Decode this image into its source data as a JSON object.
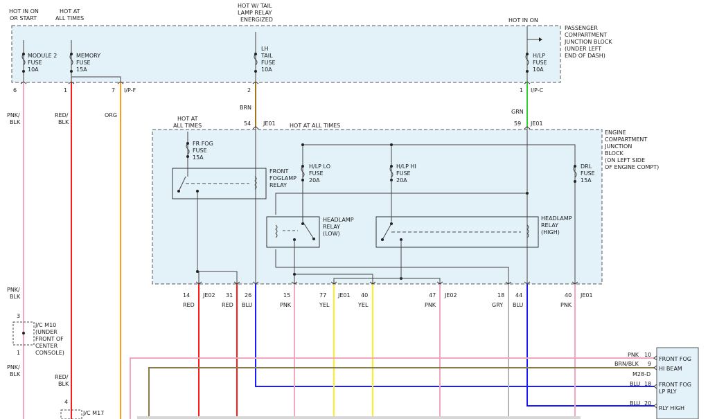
{
  "colors": {
    "pnk": "#f2a7bf",
    "red": "#ff1a1a",
    "org": "#ff9a1a",
    "brn": "#a0751f",
    "grn": "#33cc33",
    "blu": "#1a1aff",
    "yel": "#ffee22",
    "gry": "#b5b5b5",
    "brn_blk": "#8a7a4a",
    "box_fill": "#e3f1f9"
  },
  "top_labels": {
    "hot_in_on_or_start_1": "HOT IN ON",
    "hot_in_on_or_start_2": "OR START",
    "hot_at_all_times_1": "HOT AT",
    "hot_at_all_times_2": "ALL TIMES",
    "hot_tail_1": "HOT W/ TAIL",
    "hot_tail_2": "LAMP RELAY",
    "hot_tail_3": "ENERGIZED",
    "hot_in_on": "HOT IN ON"
  },
  "passenger_block": {
    "line1": "PASSENGER",
    "line2": "COMPARTMENT",
    "line3": "JUNCTION BLOCK",
    "line4": "(UNDER LEFT",
    "line5": "END OF DASH)",
    "fuses": [
      {
        "l1": "MODULE 2",
        "l2": "FUSE",
        "l3": "10A"
      },
      {
        "l1": "MEMORY",
        "l2": "FUSE",
        "l3": "15A"
      },
      {
        "l1": "LH",
        "l2": "TAIL",
        "l3": "FUSE",
        "l4": "10A"
      },
      {
        "l1": "H/LP",
        "l2": "FUSE",
        "l3": "10A"
      }
    ],
    "pins": {
      "p6": "6",
      "p1": "1",
      "p7": "7",
      "ipf": "I/P-F",
      "p2": "2",
      "p1b": "1",
      "ipc": "I/P-C"
    }
  },
  "engine_block": {
    "line1": "ENGINE",
    "line2": "COMPARTMENT",
    "line3": "JUNCTION",
    "line4": "BLOCK",
    "line5": "(ON LEFT SIDE",
    "line6": "OF ENGINE COMPT)",
    "hot_at_1": "HOT AT",
    "hot_at_2": "ALL TIMES",
    "hot_all_times": "HOT AT ALL TIMES",
    "fr_fog": {
      "l1": "FR FOG",
      "l2": "FUSE",
      "l3": "15A"
    },
    "hlp_lo": {
      "l1": "H/LP LO",
      "l2": "FUSE",
      "l3": "20A"
    },
    "hlp_hi": {
      "l1": "H/LP HI",
      "l2": "FUSE",
      "l3": "20A"
    },
    "drl": {
      "l1": "DRL",
      "l2": "FUSE",
      "l3": "15A"
    },
    "fog_relay": {
      "l1": "FRONT",
      "l2": "FOGLAMP",
      "l3": "RELAY"
    },
    "hl_low": {
      "l1": "HEADLAMP",
      "l2": "RELAY",
      "l3": "(LOW)"
    },
    "hl_high": {
      "l1": "HEADLAMP",
      "l2": "RELAY",
      "l3": "(HIGH)"
    }
  },
  "mid_labels": {
    "pnk_blk_1": "PNK/",
    "pnk_blk_2": "BLK",
    "red_blk_1": "RED/",
    "red_blk_2": "BLK",
    "org": "ORG",
    "brn": "BRN",
    "grn": "GRN",
    "pin54": "54",
    "je01_a": "JE01",
    "pin59": "59",
    "je01_b": "JE01"
  },
  "bottom_pins": [
    {
      "pin": "14",
      "conn": "JE02",
      "color": "RED"
    },
    {
      "pin": "31",
      "conn": "",
      "color": "RED"
    },
    {
      "pin": "26",
      "conn": "",
      "color": "BLU"
    },
    {
      "pin": "15",
      "conn": "",
      "color": "PNK"
    },
    {
      "pin": "77",
      "conn": "JE01",
      "color": "YEL"
    },
    {
      "pin": "40",
      "conn": "",
      "color": "YEL"
    },
    {
      "pin": "47",
      "conn": "JE02",
      "color": "PNK"
    },
    {
      "pin": "18",
      "conn": "",
      "color": "GRY"
    },
    {
      "pin": "44",
      "conn": "",
      "color": "BLU"
    },
    {
      "pin": "40",
      "conn": "JE01",
      "color": "PNK"
    }
  ],
  "left_lower": {
    "pnk_blk_1": "PNK/",
    "pnk_blk_2": "BLK",
    "pin3": "3",
    "jc_m10": "J/C M10",
    "jc_l2": "(UNDER",
    "jc_l3": "FRONT OF",
    "jc_l4": "CENTER",
    "jc_l5": "CONSOLE)",
    "pin1": "1",
    "pnk_blk_3": "PNK/",
    "pnk_blk_4": "BLK",
    "red_blk_1": "RED/",
    "red_blk_2": "BLK",
    "pin4": "4",
    "jc_m17": "J/C M17"
  },
  "right_connector": [
    {
      "wire": "PNK",
      "pin": "10",
      "label": "FRONT FOG"
    },
    {
      "wire": "BRN/BLK",
      "pin": "9",
      "label": "HI BEAM"
    },
    {
      "wire": "M28-D",
      "pin": "",
      "label": ""
    },
    {
      "wire": "BLU",
      "pin": "18",
      "label": "FRONT FOG"
    },
    {
      "wire": "",
      "pin": "",
      "label": "LP RLY"
    },
    {
      "wire": "BLU",
      "pin": "20",
      "label": "RLY HIGH"
    }
  ]
}
